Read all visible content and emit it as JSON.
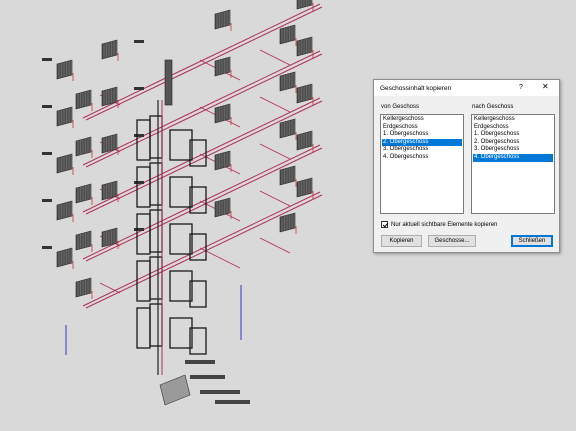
{
  "dialog": {
    "title": "Geschossinhalt kopieren",
    "help": "?",
    "close": "✕",
    "from_label": "von Geschoss",
    "to_label": "nach Geschoss",
    "from_items": [
      {
        "label": "Kellergeschoss",
        "selected": false
      },
      {
        "label": "Erdgeschoss",
        "selected": false
      },
      {
        "label": "1. Obergeschoss",
        "selected": false
      },
      {
        "label": "2. Obergeschoss",
        "selected": true
      },
      {
        "label": "3. Obergeschoss",
        "selected": false
      },
      {
        "label": "4. Obergeschoss",
        "selected": false
      }
    ],
    "to_items": [
      {
        "label": "Kellergeschoss",
        "selected": false
      },
      {
        "label": "Erdgeschoss",
        "selected": false
      },
      {
        "label": "1. Obergeschoss",
        "selected": false
      },
      {
        "label": "2. Obergeschoss",
        "selected": false
      },
      {
        "label": "3. Obergeschoss",
        "selected": false
      },
      {
        "label": "4. Obergeschoss",
        "selected": true
      }
    ],
    "checkbox_label": "Nur aktuell sichtbare Elemente kopieren",
    "checkbox_checked": true,
    "copy_button": "Kopieren",
    "floors_button": "Geschosse...",
    "close_button": "Schließen"
  },
  "drawing": {
    "colors": {
      "pipe": "#b0305a",
      "riser_blue": "#2a3bd0",
      "radiator": "#4f4f4f",
      "shaft": "#1a1a1a"
    }
  }
}
